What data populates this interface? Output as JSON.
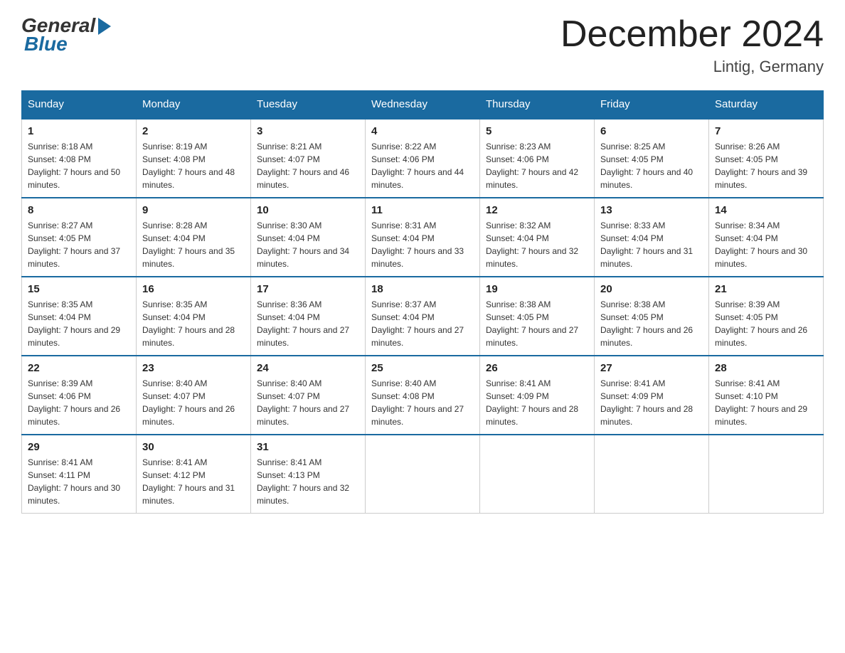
{
  "logo": {
    "general": "General",
    "blue": "Blue"
  },
  "title": "December 2024",
  "location": "Lintig, Germany",
  "days_of_week": [
    "Sunday",
    "Monday",
    "Tuesday",
    "Wednesday",
    "Thursday",
    "Friday",
    "Saturday"
  ],
  "weeks": [
    [
      {
        "day": "1",
        "sunrise": "8:18 AM",
        "sunset": "4:08 PM",
        "daylight": "7 hours and 50 minutes."
      },
      {
        "day": "2",
        "sunrise": "8:19 AM",
        "sunset": "4:08 PM",
        "daylight": "7 hours and 48 minutes."
      },
      {
        "day": "3",
        "sunrise": "8:21 AM",
        "sunset": "4:07 PM",
        "daylight": "7 hours and 46 minutes."
      },
      {
        "day": "4",
        "sunrise": "8:22 AM",
        "sunset": "4:06 PM",
        "daylight": "7 hours and 44 minutes."
      },
      {
        "day": "5",
        "sunrise": "8:23 AM",
        "sunset": "4:06 PM",
        "daylight": "7 hours and 42 minutes."
      },
      {
        "day": "6",
        "sunrise": "8:25 AM",
        "sunset": "4:05 PM",
        "daylight": "7 hours and 40 minutes."
      },
      {
        "day": "7",
        "sunrise": "8:26 AM",
        "sunset": "4:05 PM",
        "daylight": "7 hours and 39 minutes."
      }
    ],
    [
      {
        "day": "8",
        "sunrise": "8:27 AM",
        "sunset": "4:05 PM",
        "daylight": "7 hours and 37 minutes."
      },
      {
        "day": "9",
        "sunrise": "8:28 AM",
        "sunset": "4:04 PM",
        "daylight": "7 hours and 35 minutes."
      },
      {
        "day": "10",
        "sunrise": "8:30 AM",
        "sunset": "4:04 PM",
        "daylight": "7 hours and 34 minutes."
      },
      {
        "day": "11",
        "sunrise": "8:31 AM",
        "sunset": "4:04 PM",
        "daylight": "7 hours and 33 minutes."
      },
      {
        "day": "12",
        "sunrise": "8:32 AM",
        "sunset": "4:04 PM",
        "daylight": "7 hours and 32 minutes."
      },
      {
        "day": "13",
        "sunrise": "8:33 AM",
        "sunset": "4:04 PM",
        "daylight": "7 hours and 31 minutes."
      },
      {
        "day": "14",
        "sunrise": "8:34 AM",
        "sunset": "4:04 PM",
        "daylight": "7 hours and 30 minutes."
      }
    ],
    [
      {
        "day": "15",
        "sunrise": "8:35 AM",
        "sunset": "4:04 PM",
        "daylight": "7 hours and 29 minutes."
      },
      {
        "day": "16",
        "sunrise": "8:35 AM",
        "sunset": "4:04 PM",
        "daylight": "7 hours and 28 minutes."
      },
      {
        "day": "17",
        "sunrise": "8:36 AM",
        "sunset": "4:04 PM",
        "daylight": "7 hours and 27 minutes."
      },
      {
        "day": "18",
        "sunrise": "8:37 AM",
        "sunset": "4:04 PM",
        "daylight": "7 hours and 27 minutes."
      },
      {
        "day": "19",
        "sunrise": "8:38 AM",
        "sunset": "4:05 PM",
        "daylight": "7 hours and 27 minutes."
      },
      {
        "day": "20",
        "sunrise": "8:38 AM",
        "sunset": "4:05 PM",
        "daylight": "7 hours and 26 minutes."
      },
      {
        "day": "21",
        "sunrise": "8:39 AM",
        "sunset": "4:05 PM",
        "daylight": "7 hours and 26 minutes."
      }
    ],
    [
      {
        "day": "22",
        "sunrise": "8:39 AM",
        "sunset": "4:06 PM",
        "daylight": "7 hours and 26 minutes."
      },
      {
        "day": "23",
        "sunrise": "8:40 AM",
        "sunset": "4:07 PM",
        "daylight": "7 hours and 26 minutes."
      },
      {
        "day": "24",
        "sunrise": "8:40 AM",
        "sunset": "4:07 PM",
        "daylight": "7 hours and 27 minutes."
      },
      {
        "day": "25",
        "sunrise": "8:40 AM",
        "sunset": "4:08 PM",
        "daylight": "7 hours and 27 minutes."
      },
      {
        "day": "26",
        "sunrise": "8:41 AM",
        "sunset": "4:09 PM",
        "daylight": "7 hours and 28 minutes."
      },
      {
        "day": "27",
        "sunrise": "8:41 AM",
        "sunset": "4:09 PM",
        "daylight": "7 hours and 28 minutes."
      },
      {
        "day": "28",
        "sunrise": "8:41 AM",
        "sunset": "4:10 PM",
        "daylight": "7 hours and 29 minutes."
      }
    ],
    [
      {
        "day": "29",
        "sunrise": "8:41 AM",
        "sunset": "4:11 PM",
        "daylight": "7 hours and 30 minutes."
      },
      {
        "day": "30",
        "sunrise": "8:41 AM",
        "sunset": "4:12 PM",
        "daylight": "7 hours and 31 minutes."
      },
      {
        "day": "31",
        "sunrise": "8:41 AM",
        "sunset": "4:13 PM",
        "daylight": "7 hours and 32 minutes."
      },
      null,
      null,
      null,
      null
    ]
  ]
}
